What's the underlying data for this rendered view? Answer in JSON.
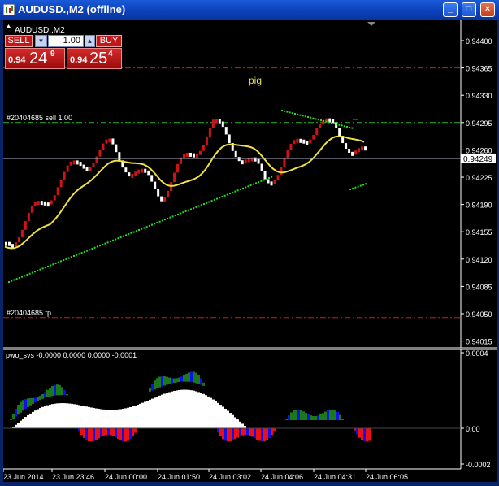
{
  "window": {
    "title": "AUDUSD.,M2 (offline)",
    "buttons": {
      "minimize": "_",
      "maximize": "□",
      "close": "×"
    },
    "frame_color": "#0a246a"
  },
  "chart": {
    "symbol_label": "AUDUSD.,M2",
    "background": "#000000",
    "main_panel": {
      "y_ticks": [
        "0.94400",
        "0.94365",
        "0.94330",
        "0.94295",
        "0.94260",
        "0.94225",
        "0.94190",
        "0.94155",
        "0.94120",
        "0.94085",
        "0.94050",
        "0.94015"
      ],
      "current_price": "0.94249",
      "annotation": "pig",
      "order_lines": [
        {
          "label": "#20404685 sell 1.00",
          "price": 0.94295,
          "style": "dash-dot",
          "color": "#2ab82a"
        },
        {
          "label": "#20404685 tp",
          "price": 0.94045,
          "style": "dash-dot",
          "color": "#d01a1a"
        },
        {
          "label": "",
          "price": 0.94365,
          "style": "dash-dot",
          "color": "#d01a1a"
        }
      ]
    },
    "sub_panel": {
      "label": "pwo_svs -0.0000 0.0000 0.0000 -0.0001",
      "y_ticks": [
        "0.0004",
        "0.00",
        "-0.0002"
      ]
    },
    "x_ticks": [
      "23 Jun 2014",
      "23 Jun 23:46",
      "24 Jun 00:00",
      "24 Jun 01:50",
      "24 Jun 03:02",
      "24 Jun 04:06",
      "24 Jun 04:31",
      "24 Jun 06:05"
    ],
    "colors": {
      "bull": "#d01414",
      "bear": "#ffffff",
      "ma": "#f0e040",
      "psar": "#22dd22",
      "grid_text": "#ffffff",
      "ind_green": "#1a7a1a",
      "ind_blue": "#1010ee",
      "ind_red": "#ee1010",
      "ind_white": "#ffffff"
    }
  },
  "trade_panel": {
    "sell_label": "SELL",
    "buy_label": "BUY",
    "lot_value": "1.00",
    "sell_price": {
      "prefix": "0.94",
      "big": "24",
      "sup": "9"
    },
    "buy_price": {
      "prefix": "0.94",
      "big": "25",
      "sup": "4"
    }
  },
  "chart_data": {
    "type": "line",
    "x": [
      "23 Jun 2014",
      "23 Jun 23:46",
      "24 Jun 00:00",
      "24 Jun 01:50",
      "24 Jun 03:02",
      "24 Jun 04:06",
      "24 Jun 04:31",
      "24 Jun 06:05"
    ],
    "series": [
      {
        "values": [
          0.94142,
          0.94222,
          0.94258,
          0.94212,
          0.94285,
          0.94228,
          0.94292,
          0.94249
        ]
      }
    ],
    "ylim": [
      0.94,
      0.9442
    ]
  }
}
